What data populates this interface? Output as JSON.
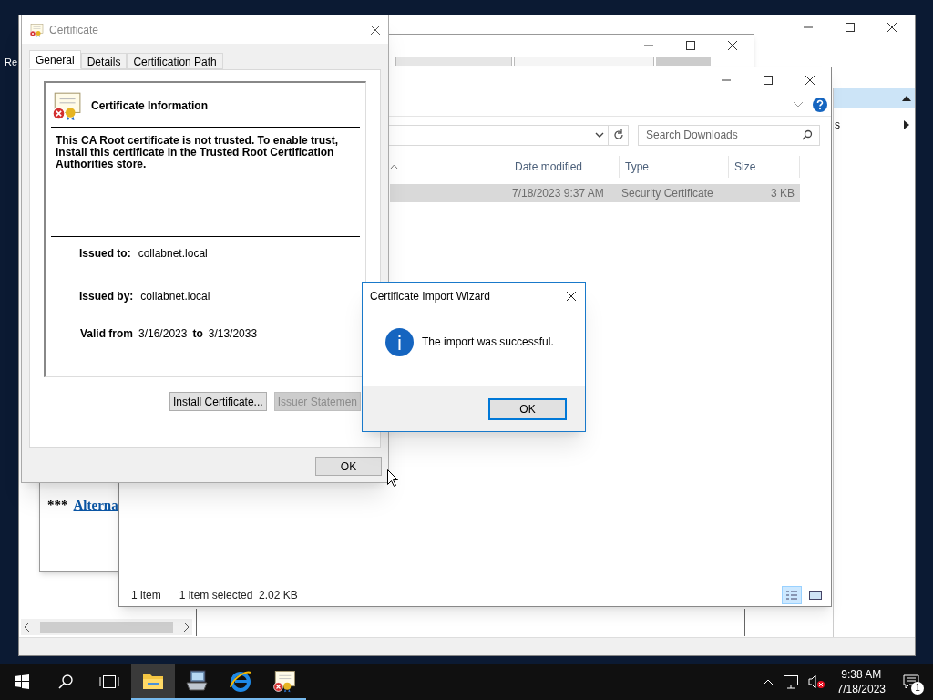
{
  "desktop": {
    "icon_label": "Re"
  },
  "back_window": {
    "side_text": "s"
  },
  "browser": {
    "link_prefix": "***",
    "link": "Alterna"
  },
  "explorer": {
    "search": {
      "placeholder": "Search Downloads"
    },
    "columns": [
      "Date modified",
      "Type",
      "Size"
    ],
    "rows": [
      {
        "selected": true,
        "cells": [
          "7/18/2023 9:37 AM",
          "Security Certificate",
          "3 KB"
        ]
      }
    ],
    "status": [
      "1 item",
      "1 item selected  2.02 KB"
    ],
    "views": [
      {
        "kind": "details",
        "selected": true
      },
      {
        "kind": "preview",
        "selected": false
      }
    ]
  },
  "certificate": {
    "title": "Certificate",
    "tabs": [
      {
        "label": "General",
        "selected": true
      },
      {
        "label": "Details",
        "selected": false
      },
      {
        "label": "Certification Path",
        "selected": false
      }
    ],
    "heading": "Certificate Information",
    "message": "This CA Root certificate is not trusted. To enable trust, install this certificate in the Trusted Root Certification Authorities store.",
    "issued_to": {
      "label": "Issued to:",
      "value": "collabnet.local"
    },
    "issued_by": {
      "label": "Issued by:",
      "value": "collabnet.local"
    },
    "valid": {
      "label": "Valid from",
      "from": "3/16/2023",
      "to_label": "to",
      "to": "3/13/2033"
    },
    "buttons": [
      {
        "label": "Install Certificate...",
        "disabled": false
      },
      {
        "label": "Issuer Statemen",
        "disabled": true
      }
    ],
    "ok": "OK"
  },
  "wizard": {
    "title": "Certificate Import Wizard",
    "message": "The import was successful.",
    "ok": "OK"
  },
  "taskbar": {
    "apps": [
      {
        "kind": "explorer",
        "active": true
      },
      {
        "kind": "server",
        "active": false
      },
      {
        "kind": "browser",
        "active": false
      },
      {
        "kind": "certificate",
        "active": false
      }
    ],
    "time": "9:38 AM",
    "date": "7/18/2023",
    "notifications": "1"
  }
}
